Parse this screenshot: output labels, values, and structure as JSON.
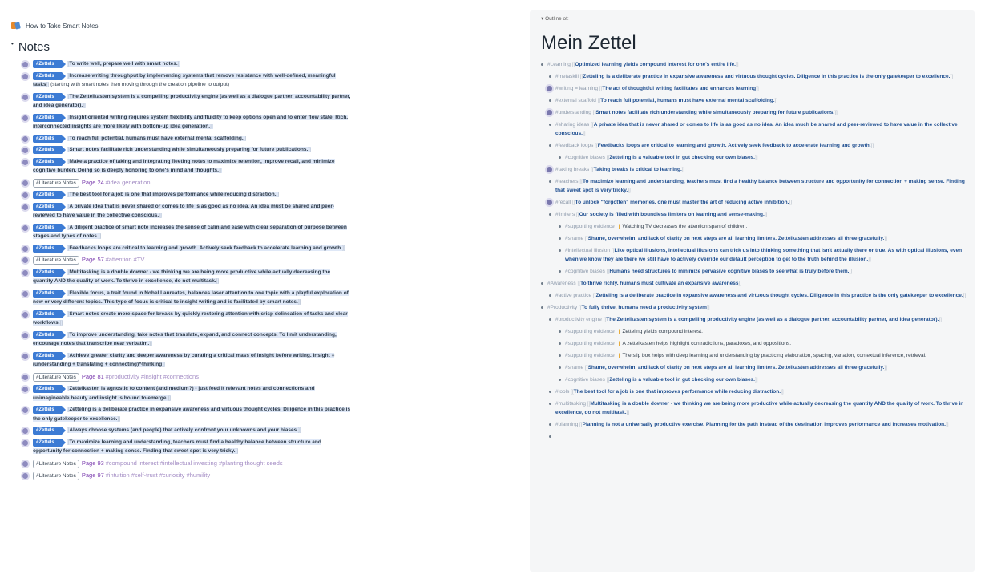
{
  "left": {
    "breadcrumb": "How to Take Smart Notes",
    "page_title": "Notes",
    "notes": [
      {
        "kind": "z",
        "tag": "#Zettels",
        "text": "To write well, prepare well with smart notes."
      },
      {
        "kind": "z",
        "tag": "#Zettels",
        "text": "Increase writing throughput by implementing systems that remove resistance with well-defined, meaningful tasks",
        "plain": "(starting with smart notes then moving through the creation pipeline to output)"
      },
      {
        "kind": "z",
        "tag": "#Zettels",
        "text": "The Zettelkasten system is a compelling productivity engine (as well as a dialogue partner, accountability partner, and idea generator)."
      },
      {
        "kind": "z",
        "tag": "#Zettels",
        "text": "Insight-oriented writing requires system flexibility and fluidity to keep options open and to enter flow state. Rich, interconnected insights are more likely with bottom-up idea generation."
      },
      {
        "kind": "z",
        "tag": "#Zettels",
        "text": "To reach full potential, humans must have external mental scaffolding."
      },
      {
        "kind": "z",
        "tag": "#Zettels",
        "text": "Smart notes facilitate rich understanding while simultaneously preparing for future publications."
      },
      {
        "kind": "z",
        "tag": "#Zettels",
        "text": "Make a practice of taking and integrating fleeting notes to maximize retention, improve recall, and minimize cognitive burden. Doing so is deeply honoring to one's mind and thoughts."
      },
      {
        "kind": "l",
        "lit": "#Literature Notes",
        "page": "Page 24",
        "tags": "#idea generation"
      },
      {
        "kind": "z",
        "tag": "#Zettels",
        "text": "The best tool for a job is one that improves performance while reducing distraction."
      },
      {
        "kind": "z",
        "tag": "#Zettels",
        "text": "A private idea that is never shared or comes to life is as good as no idea. An idea must be shared and peer-reviewed to have value in the collective conscious."
      },
      {
        "kind": "z",
        "tag": "#Zettels",
        "text": "A diligent practice of smart note increases the sense of calm and ease with clear separation of purpose between stages and types of notes."
      },
      {
        "kind": "z",
        "tag": "#Zettels",
        "text": "Feedbacks loops are critical to learning and growth. Actively seek feedback to accelerate learning and growth."
      },
      {
        "kind": "l",
        "lit": "#Literature Notes",
        "page": "Page 57",
        "tags": "#attention #TV"
      },
      {
        "kind": "z",
        "tag": "#Zettels",
        "text": "Multitasking is a double downer - we thinking we are being more productive while actually decreasing the quantity AND the quality of work. To thrive in excellence, do not multitask."
      },
      {
        "kind": "z",
        "tag": "#Zettels",
        "text": "Flexible focus, a trait found in Nobel Laureates, balances laser attention to one topic with a playful exploration of new or very different topics. This type of focus is critical to insight writing and is facilitated by smart notes."
      },
      {
        "kind": "z",
        "tag": "#Zettels",
        "text": "Smart notes create more space for breaks by quickly restoring attention with crisp delineation of tasks and clear workflows."
      },
      {
        "kind": "z",
        "tag": "#Zettels",
        "text": "To improve understanding, take notes that translate, expand, and connect concepts. To limit understanding, encourage notes that transcribe near verbatim."
      },
      {
        "kind": "z",
        "tag": "#Zettels",
        "text": "Achieve greater clarity and deeper awareness by curating a critical mass of insight before writing. Insight = (understanding + translating + connecting)^thinking"
      },
      {
        "kind": "l",
        "lit": "#Literature Notes",
        "page": "Page 81",
        "tags": "#productivity #insight #connections"
      },
      {
        "kind": "z",
        "tag": "#Zettels",
        "text": "Zettelkasten is agnostic to content (and medium?) - just feed it relevant notes and connections and unimagineable beauty and insight is bound to emerge."
      },
      {
        "kind": "z",
        "tag": "#Zettels",
        "text": "Zetteling is a deliberate practice in expansive awareness and virtuous thought cycles. Diligence in this practice is the only gatekeeper to excellence."
      },
      {
        "kind": "z",
        "tag": "#Zettels",
        "text": "Always choose systems (and people) that actively confront your unknowns and your biases."
      },
      {
        "kind": "z",
        "tag": "#Zettels",
        "text": "To maximize learning and understanding, teachers must find a healthy balance between structure and opportunity for connection + making sense. Finding that sweet spot is very tricky."
      },
      {
        "kind": "l",
        "lit": "#Literature Notes",
        "page": "Page 93",
        "tags": "#compound interest #intellectual investing #planting thought seeds"
      },
      {
        "kind": "l",
        "lit": "#Literature Notes",
        "page": "Page 97",
        "tags": "#intuition #self-trust #curiosity #humility"
      }
    ]
  },
  "right": {
    "outline_label": "Outline of:",
    "title": "Mein Zettel",
    "items": [
      {
        "lvl": 1,
        "b": "dot",
        "h": "#Learning",
        "t": "Optimized learning yields compound interest for one's entire life."
      },
      {
        "lvl": 2,
        "b": "dot",
        "h": "#metaskill",
        "t": "Zetteling is a deliberate practice in expansive awareness and virtuous thought cycles. Diligence in this practice is the only gatekeeper to excellence."
      },
      {
        "lvl": 2,
        "b": "ring",
        "h": "#writing = learning",
        "t": "The act of thoughtful writing facilitates and enhances learning"
      },
      {
        "lvl": 2,
        "b": "dot",
        "h": "#external scaffold",
        "t": "To reach full potential, humans must have external mental scaffolding."
      },
      {
        "lvl": 2,
        "b": "ring",
        "h": "#understanding",
        "t": "Smart notes facilitate rich understanding while simultaneously preparing for future publications."
      },
      {
        "lvl": 2,
        "b": "dot",
        "h": "#sharing ideas",
        "t": "A private idea that is never shared or comes to life is as good as no idea. An idea much be shared and peer-reviewed to have value in the collective conscious."
      },
      {
        "lvl": 2,
        "b": "dot",
        "h": "#feedback loops",
        "t": "Feedbacks loops are critical to learning and growth. Actively seek feedback to accelerate learning and growth."
      },
      {
        "lvl": 3,
        "b": "dot",
        "h": "#cognitive biases",
        "t": "Zetteling is a valuable tool in gut checking our own biases."
      },
      {
        "lvl": 2,
        "b": "ring",
        "h": "#taking breaks",
        "t": "Taking breaks is critical to learning."
      },
      {
        "lvl": 2,
        "b": "dot",
        "h": "#teachers",
        "t": "To maximize learning and understanding, teachers must find a healthy balance between structure and opportunity for connection + making sense. Finding that sweet spot is very tricky."
      },
      {
        "lvl": 2,
        "b": "ring",
        "h": "#recall",
        "t": "To unlock \"forgotten\" memories, one must master the art of reducing active inhibition."
      },
      {
        "lvl": 2,
        "b": "dot",
        "h": "#limiters",
        "t": "Our society is filled with boundless limiters on learning and sense-making."
      },
      {
        "lvl": 3,
        "b": "dot",
        "h": "#supporting evidence",
        "ev": "Watching TV decreases the attention span of children."
      },
      {
        "lvl": 3,
        "b": "dot",
        "h": "#shame",
        "t": "Shame, overwhelm, and lack of clarity on next steps are all learning limiters. Zettelkasten addresses all three gracefully."
      },
      {
        "lvl": 3,
        "b": "dot",
        "h": "#intellectual illusion",
        "t": "Like optical illusions, intellectual illusions can trick us into thinking something that isn't actually there or true. As with optical illusions, even when we know they are there we still have to actively override our default perception to get to the truth behind the illusion."
      },
      {
        "lvl": 3,
        "b": "dot",
        "h": "#cognitive biases",
        "t": "Humans need structures to minimize pervasive cognitive biases to see what is truly before them."
      },
      {
        "lvl": 1,
        "b": "dot",
        "h": "#Awareness",
        "t": "To thrive richly, humans must cultivate an expansive awareness"
      },
      {
        "lvl": 2,
        "b": "dot",
        "h": "#active practice",
        "t": "Zetteling is a deliberate practice in expansive awareness and virtuous thought cycles. Diligence in this practice is the only gatekeeper to excellence."
      },
      {
        "lvl": 1,
        "b": "dot",
        "h": "#Productivity",
        "t": "To fully thrive, humans need a productivity system"
      },
      {
        "lvl": 2,
        "b": "dot",
        "h": "#productivity engine",
        "t": "The Zettelkasten system is a compelling productivity engine (as well as a dialogue partner, accountability partner, and idea generator)."
      },
      {
        "lvl": 3,
        "b": "dot",
        "h": "#supporting evidence",
        "ev": "Zetteling yields compound interest."
      },
      {
        "lvl": 3,
        "b": "dot",
        "h": "#supporting evidence",
        "ev": "A zettelkasten helps highlight contradictions, paradoxes, and oppositions."
      },
      {
        "lvl": 3,
        "b": "dot",
        "h": "#supporting evidence",
        "ev": "The slip box helps with deep learning and understanding by practicing elaboration, spacing, variation, contextual inference, retrieval."
      },
      {
        "lvl": 3,
        "b": "dot",
        "h": "#shame",
        "t": "Shame, overwhelm, and lack of clarity on next steps are all learning limiters. Zettelkasten addresses all three gracefully."
      },
      {
        "lvl": 3,
        "b": "dot",
        "h": "#cognitive biases",
        "t": "Zetteling is a valuable tool in gut checking our own biases."
      },
      {
        "lvl": 2,
        "b": "dot",
        "h": "#tools",
        "t": "The best tool for a job is one that improves performance while reducing distraction."
      },
      {
        "lvl": 2,
        "b": "dot",
        "h": "#multitasking",
        "t": "Multitasking is a double downer - we thinking we are being more productive while actually decreasing the quantity AND the quality of work. To thrive in excellence, do not multitask."
      },
      {
        "lvl": 2,
        "b": "dot",
        "h": "#planning",
        "t": "Planning is not a universally productive exercise. Planning for the path instead of the destination improves performance and increases motivation."
      },
      {
        "lvl": 2,
        "b": "dot",
        "h": "",
        "t": ""
      }
    ]
  }
}
